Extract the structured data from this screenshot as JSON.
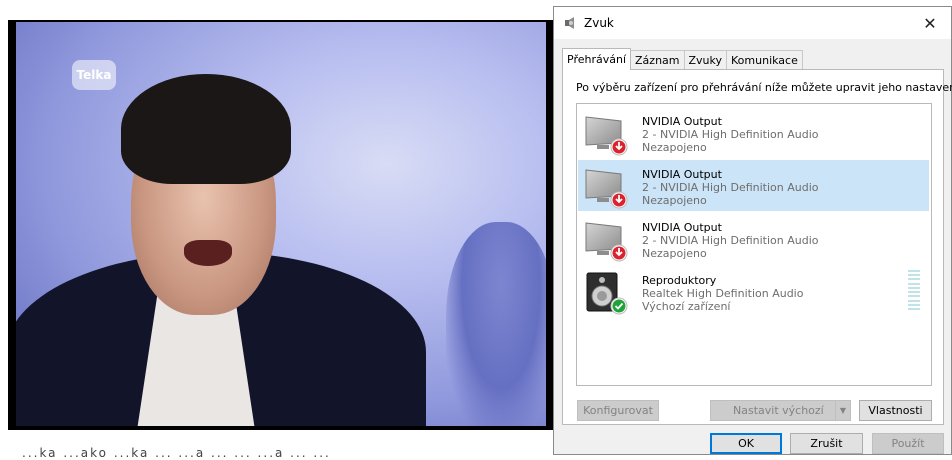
{
  "video": {
    "logo_text": "Telka",
    "caption": "...ka ...ako ...ka ... ...a ... ... ...a ... ..."
  },
  "dialog": {
    "title": "Zvuk",
    "close_symbol": "✕",
    "tabs": [
      {
        "label": "Přehrávání",
        "active": true
      },
      {
        "label": "Záznam",
        "active": false
      },
      {
        "label": "Zvuky",
        "active": false
      },
      {
        "label": "Komunikace",
        "active": false
      }
    ],
    "instruction": "Po výběru zařízení pro přehrávání níže můžete upravit jeho nastavení:",
    "devices": [
      {
        "name": "NVIDIA Output",
        "driver": "2 - NVIDIA High Definition Audio",
        "status": "Nezapojeno",
        "icon": "monitor-disconnected-icon",
        "selected": false
      },
      {
        "name": "NVIDIA Output",
        "driver": "2 - NVIDIA High Definition Audio",
        "status": "Nezapojeno",
        "icon": "monitor-disconnected-icon",
        "selected": true
      },
      {
        "name": "NVIDIA Output",
        "driver": "2 - NVIDIA High Definition Audio",
        "status": "Nezapojeno",
        "icon": "monitor-disconnected-icon",
        "selected": false
      },
      {
        "name": "Reproduktory",
        "driver": "Realtek High Definition Audio",
        "status": "Výchozí zařízení",
        "icon": "speaker-default-icon",
        "selected": false
      }
    ],
    "buttons": {
      "configure": "Konfigurovat",
      "set_default": "Nastavit výchozí",
      "properties": "Vlastnosti",
      "ok": "OK",
      "cancel": "Zrušit",
      "apply": "Použít"
    },
    "colors": {
      "selected_row": "#cce4f7",
      "primary_border": "#0078d7",
      "disconnected_badge": "#d9232e",
      "default_badge": "#21a33a"
    }
  }
}
